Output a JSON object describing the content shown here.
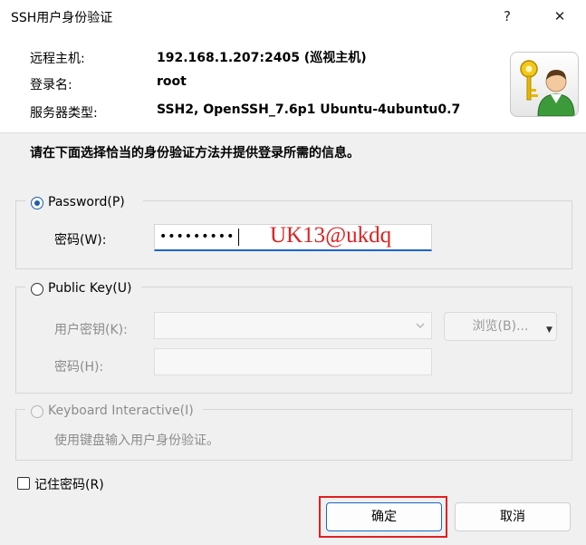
{
  "window": {
    "title": "SSH用户身份验证",
    "help_label": "?",
    "close_label": "✕"
  },
  "info": {
    "host_label": "远程主机:",
    "host_value": "192.168.1.207:2405 (巡视主机)",
    "login_label": "登录名:",
    "login_value": "root",
    "server_type_label": "服务器类型:",
    "server_type_value": "SSH2, OpenSSH_7.6p1 Ubuntu-4ubuntu0.7"
  },
  "note": "请在下面选择恰当的身份验证方法并提供登录所需的信息。",
  "password_section": {
    "radio_label": "Password(P)",
    "password_label": "密码(W):",
    "password_mask": "•••••••••",
    "annotation": "UK13@ukdq"
  },
  "public_key_section": {
    "radio_label": "Public Key(U)",
    "user_key_label": "用户密钥(K):",
    "browse_label": "浏览(B)...",
    "passphrase_label": "密码(H):"
  },
  "keyboard_section": {
    "radio_label": "Keyboard Interactive(I)",
    "description": "使用键盘输入用户身份验证。"
  },
  "remember_label": "记住密码(R)",
  "buttons": {
    "ok": "确定",
    "cancel": "取消"
  },
  "icons": {
    "avatar": "user-key-icon",
    "dropdown": "chevron-down-icon"
  },
  "colors": {
    "accent": "#1a66c2",
    "annotation": "#e02020"
  }
}
